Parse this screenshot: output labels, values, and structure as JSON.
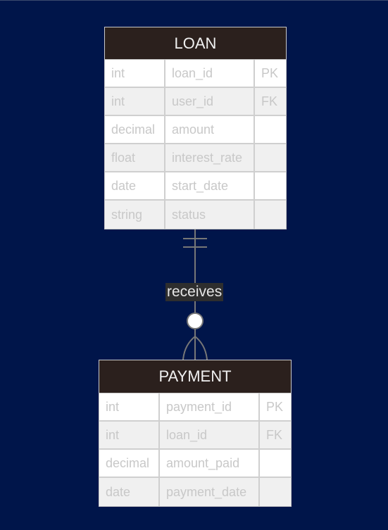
{
  "entities": [
    {
      "name": "LOAN",
      "attributes": [
        {
          "type": "int",
          "name": "loan_id",
          "key": "PK"
        },
        {
          "type": "int",
          "name": "user_id",
          "key": "FK"
        },
        {
          "type": "decimal",
          "name": "amount",
          "key": ""
        },
        {
          "type": "float",
          "name": "interest_rate",
          "key": ""
        },
        {
          "type": "date",
          "name": "start_date",
          "key": ""
        },
        {
          "type": "string",
          "name": "status",
          "key": ""
        }
      ]
    },
    {
      "name": "PAYMENT",
      "attributes": [
        {
          "type": "int",
          "name": "payment_id",
          "key": "PK"
        },
        {
          "type": "int",
          "name": "loan_id",
          "key": "FK"
        },
        {
          "type": "decimal",
          "name": "amount_paid",
          "key": ""
        },
        {
          "type": "date",
          "name": "payment_date",
          "key": ""
        }
      ]
    }
  ],
  "relationship": {
    "label": "receives",
    "from": "LOAN",
    "to": "PAYMENT",
    "from_cardinality": "exactly-one",
    "to_cardinality": "zero-or-many"
  },
  "colors": {
    "background": "#00154a",
    "header": "#2b201d",
    "line": "#777777"
  }
}
